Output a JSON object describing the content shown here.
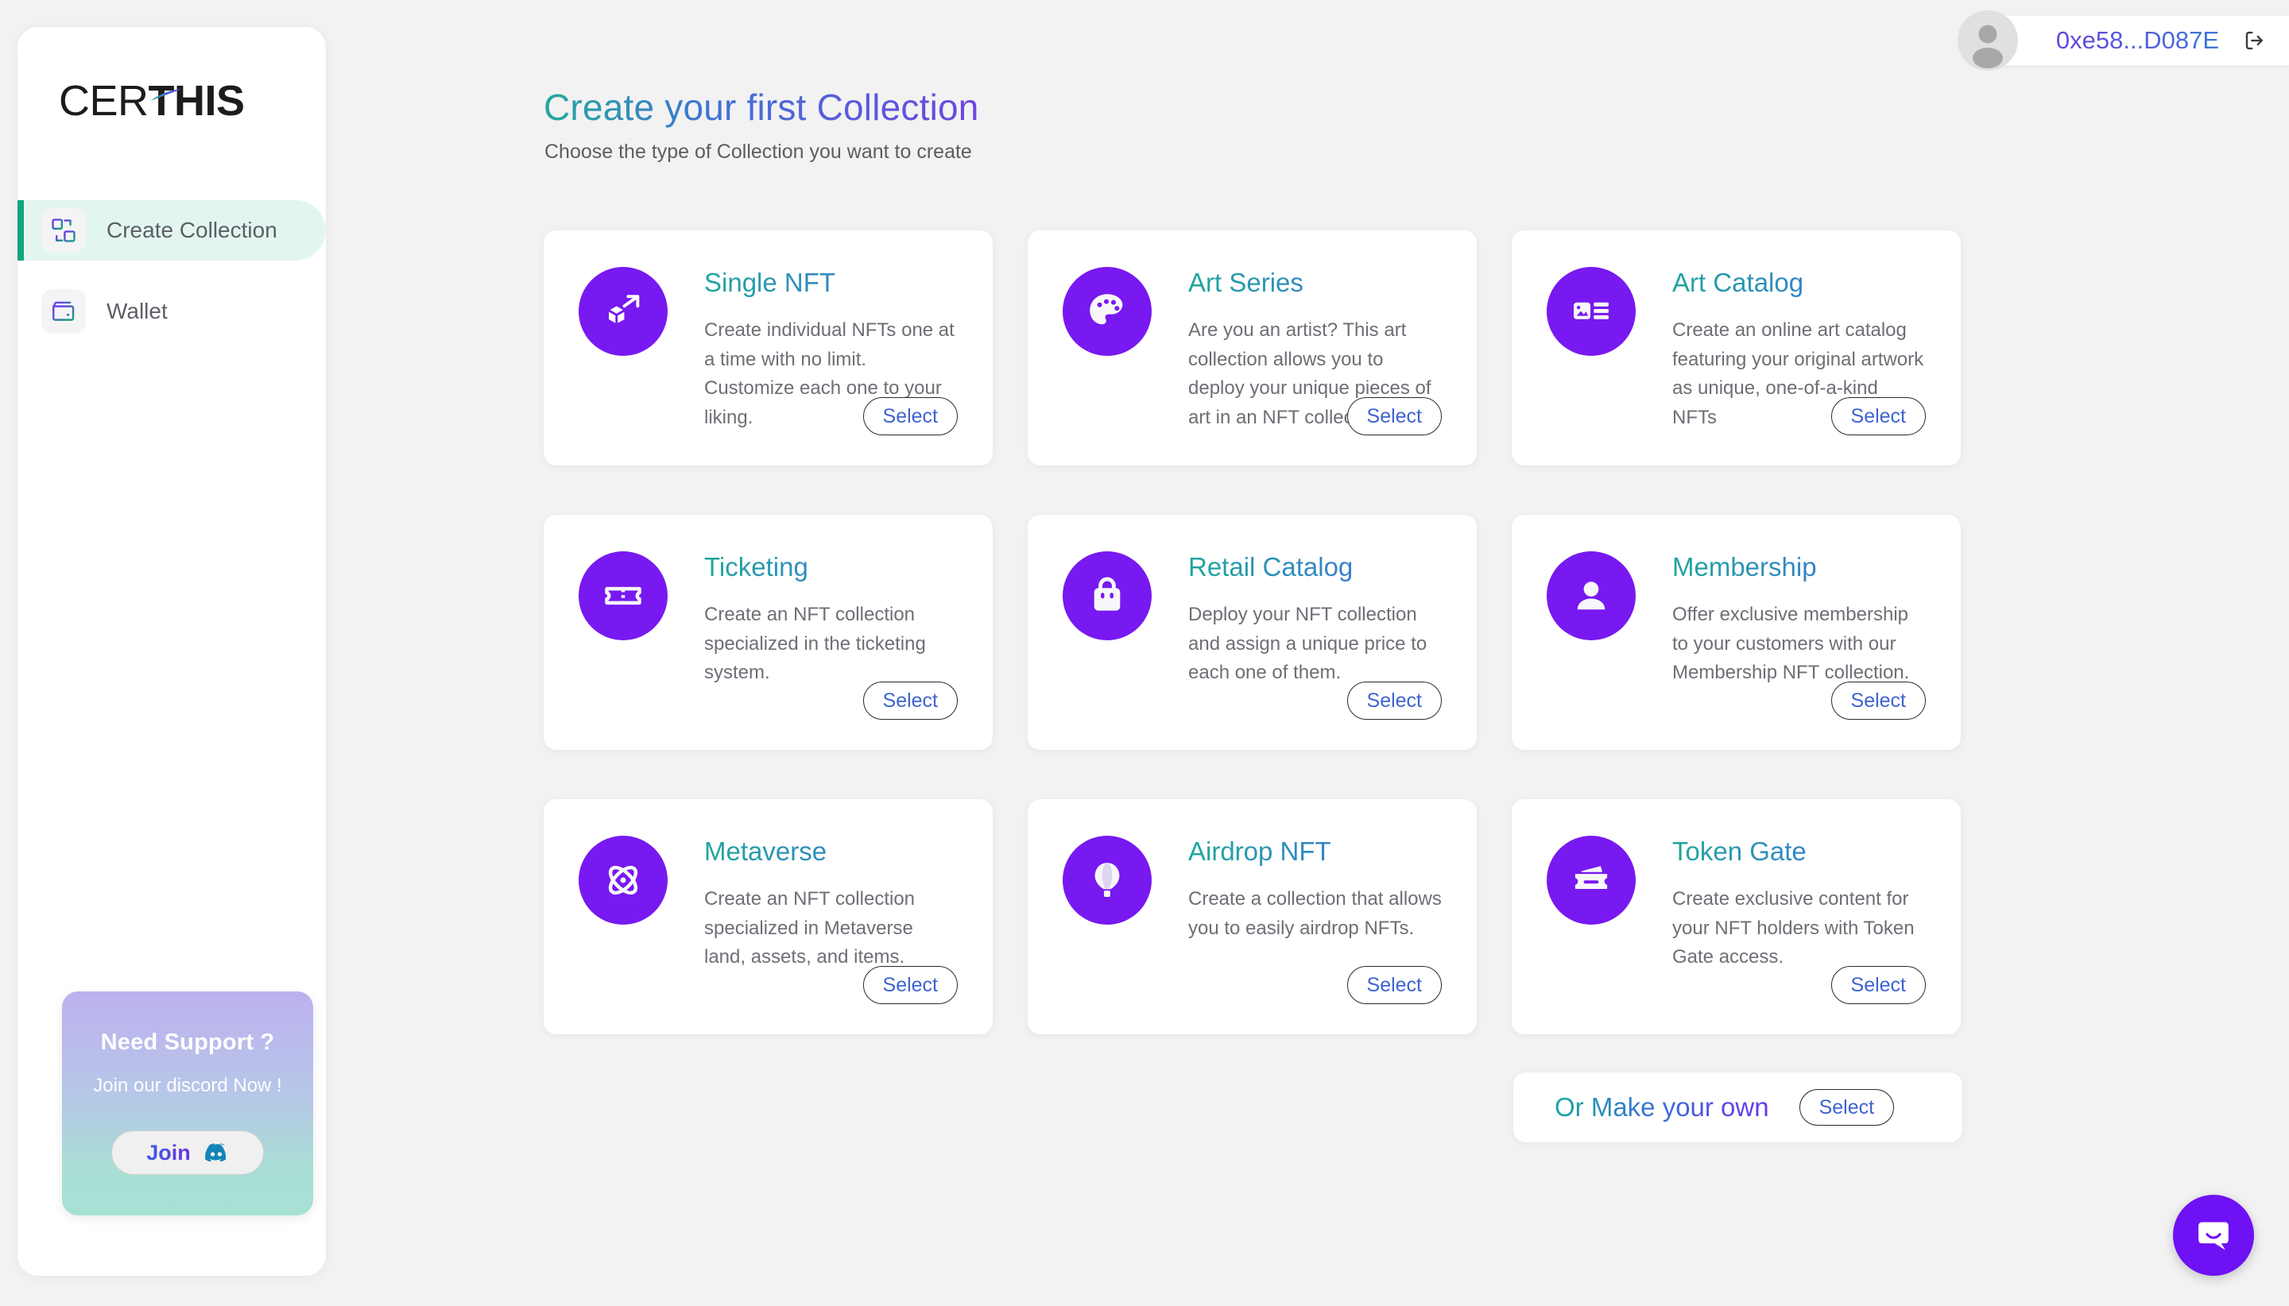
{
  "brand": {
    "logo_light": "CER",
    "logo_bold": "THIS"
  },
  "sidebar": {
    "items": [
      {
        "label": "Create Collection",
        "icon": "collection-icon",
        "active": true
      },
      {
        "label": "Wallet",
        "icon": "wallet-icon",
        "active": false
      }
    ],
    "support": {
      "title": "Need Support ?",
      "subtitle": "Join our discord Now !",
      "button_label": "Join",
      "button_icon": "discord-icon",
      "gradient_from": "#bdb0ef",
      "gradient_to": "#a6e1d4"
    }
  },
  "header": {
    "wallet_address": "0xe58...D087E",
    "avatar_icon": "user-avatar-icon",
    "logout_icon": "logout-icon"
  },
  "main": {
    "title": "Create your first Collection",
    "subtitle": "Choose the type of Collection you want to create",
    "select_label": "Select",
    "cards": [
      {
        "title": "Single NFT",
        "description": "Create individual NFTs one at a time with no limit. Customize each one to your liking.",
        "icon": "cube-arrow-icon",
        "select_label": "Select"
      },
      {
        "title": "Art Series",
        "description": "Are you an artist? This art collection allows you to deploy your unique pieces of art in an NFT collection.",
        "icon": "palette-icon",
        "select_label": "Select"
      },
      {
        "title": "Art Catalog",
        "description": "Create an online art catalog featuring your original artwork as unique, one-of-a-kind NFTs",
        "icon": "image-list-icon",
        "select_label": "Select"
      },
      {
        "title": "Ticketing",
        "description": "Create an NFT collection specialized in the ticketing system.",
        "icon": "ticket-icon",
        "select_label": "Select"
      },
      {
        "title": "Retail Catalog",
        "description": "Deploy your NFT collection and assign a unique price to each one of them.",
        "icon": "shopping-bag-icon",
        "select_label": "Select"
      },
      {
        "title": "Membership",
        "description": "Offer exclusive membership to your customers with our Membership NFT collection.",
        "icon": "person-icon",
        "select_label": "Select"
      },
      {
        "title": "Metaverse",
        "description": "Create an NFT collection specialized in Metaverse land, assets, and items.",
        "icon": "atom-icon",
        "select_label": "Select"
      },
      {
        "title": "Airdrop NFT",
        "description": "Create a collection that allows you to easily airdrop NFTs.",
        "icon": "hot-air-balloon-icon",
        "select_label": "Select"
      },
      {
        "title": "Token Gate",
        "description": "Create exclusive content for your NFT holders with Token Gate access.",
        "icon": "tickets-icon",
        "select_label": "Select"
      }
    ],
    "make_your_own": {
      "label": "Or Make your own",
      "select_label": "Select"
    }
  },
  "chat": {
    "icon": "chat-bubble-smile-icon"
  },
  "colors": {
    "page_background": "#f2f2f2",
    "card_background": "#ffffff",
    "icon_circle": "#7719f0",
    "active_nav_background": "#e2f6ef",
    "active_nav_bar": "#12a57e",
    "select_text": "#3f63cf",
    "chat_launcher": "#6f11f5"
  }
}
